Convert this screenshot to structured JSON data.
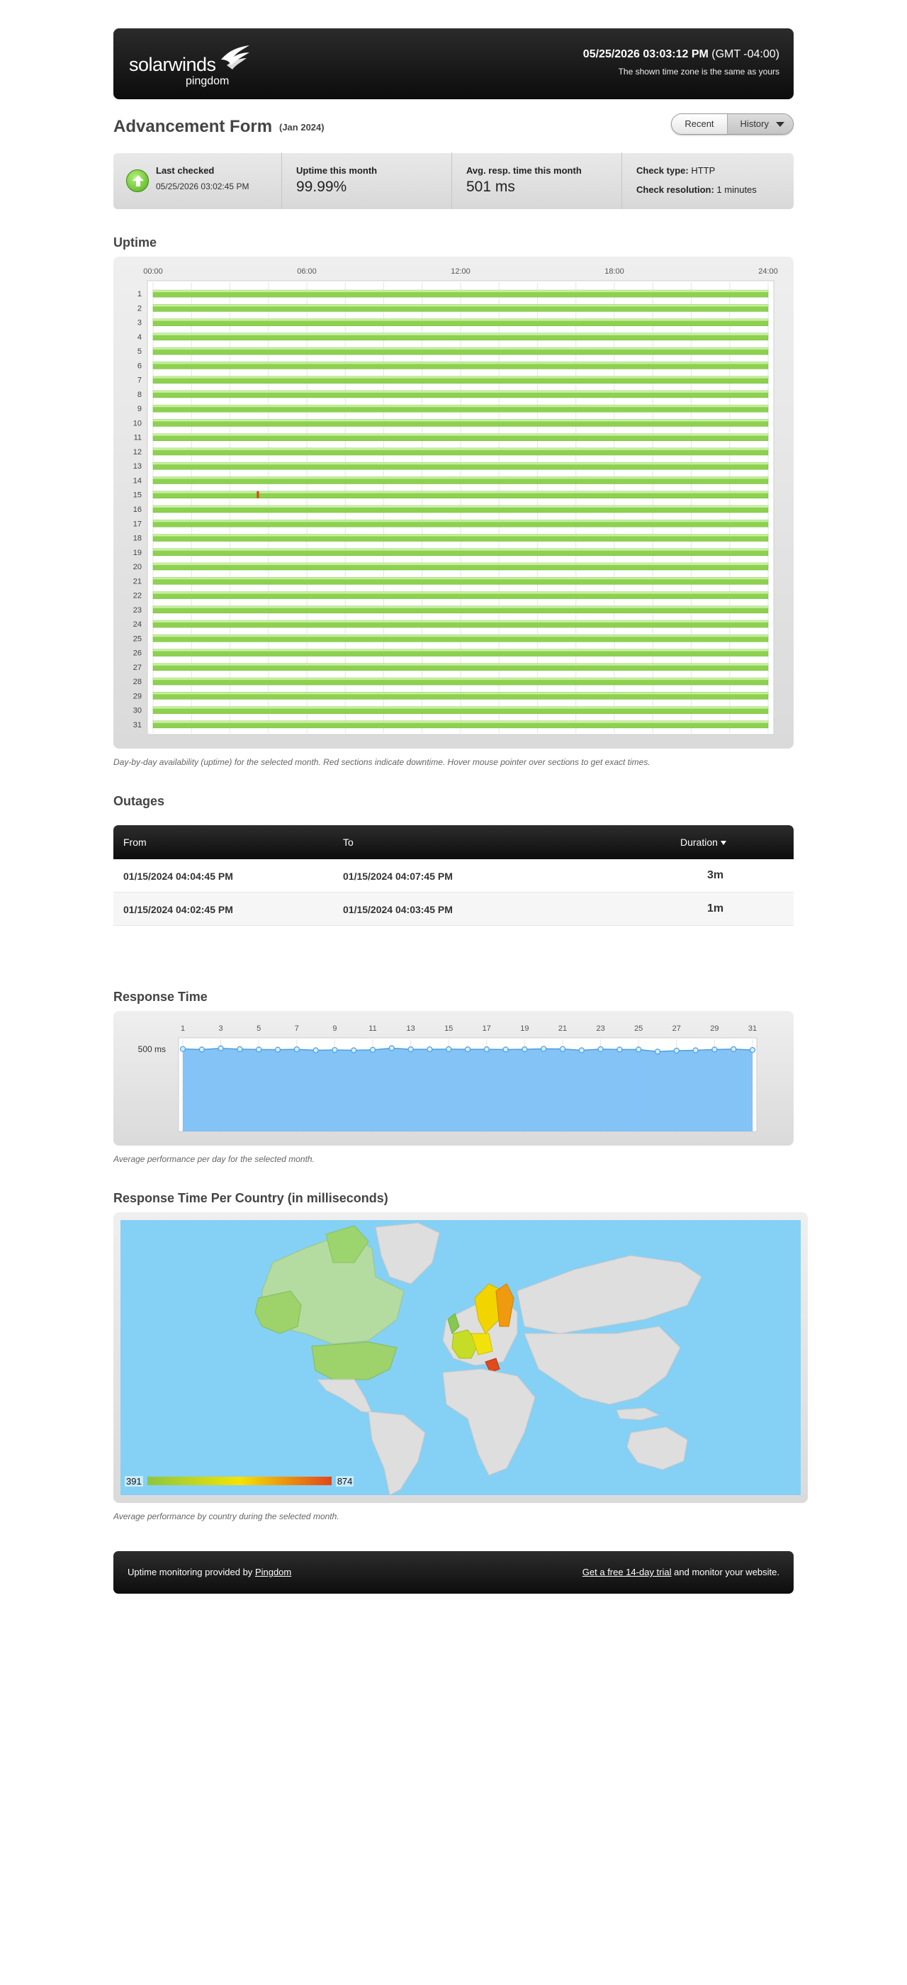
{
  "header": {
    "brand": "solarwinds",
    "product": "pingdom",
    "datetime": "05/25/2026 03:03:12 PM",
    "timezone": "(GMT -04:00)",
    "tz_note": "The shown time zone is the same as yours"
  },
  "page": {
    "title": "Advancement Form",
    "period": "(Jan 2024)",
    "view_toggle": {
      "recent": "Recent",
      "history": "History"
    }
  },
  "summary": {
    "last_checked_label": "Last checked",
    "last_checked_value": "05/25/2026 03:02:45 PM",
    "uptime_label": "Uptime this month",
    "uptime_value": "99.99%",
    "avg_resp_label": "Avg. resp. time this month",
    "avg_resp_value": "501 ms",
    "check_type_label": "Check type:",
    "check_type_value": "HTTP",
    "check_res_label": "Check resolution:",
    "check_res_value": "1 minutes"
  },
  "uptime": {
    "title": "Uptime",
    "caption": "Day-by-day availability (uptime) for the selected month. Red sections indicate downtime. Hover mouse pointer over sections to get exact times.",
    "hour_ticks": [
      "00:00",
      "06:00",
      "12:00",
      "18:00",
      "24:00"
    ],
    "days": [
      "1",
      "2",
      "3",
      "4",
      "5",
      "6",
      "7",
      "8",
      "9",
      "10",
      "11",
      "12",
      "13",
      "14",
      "15",
      "16",
      "17",
      "18",
      "19",
      "20",
      "21",
      "22",
      "23",
      "24",
      "25",
      "26",
      "27",
      "28",
      "29",
      "30",
      "31"
    ],
    "downtime": [
      {
        "day": 15,
        "from": "04:02:45",
        "to": "04:03:45"
      },
      {
        "day": 15,
        "from": "04:04:45",
        "to": "04:07:45"
      }
    ],
    "colors": {
      "up": "#8dd14f",
      "down": "#e2461a"
    }
  },
  "outages": {
    "title": "Outages",
    "headers": {
      "from": "From",
      "to": "To",
      "duration": "Duration"
    },
    "rows": [
      {
        "from": "01/15/2024 04:04:45 PM",
        "to": "01/15/2024 04:07:45 PM",
        "duration": "3m"
      },
      {
        "from": "01/15/2024 04:02:45 PM",
        "to": "01/15/2024 04:03:45 PM",
        "duration": "1m"
      }
    ]
  },
  "response": {
    "title": "Response Time",
    "caption": "Average performance per day for the selected month.",
    "y_tick": "500 ms",
    "x_ticks": [
      "1",
      "3",
      "5",
      "7",
      "9",
      "11",
      "13",
      "15",
      "17",
      "19",
      "21",
      "23",
      "25",
      "27",
      "29",
      "31"
    ],
    "chart_data": {
      "type": "area",
      "x": [
        1,
        2,
        3,
        4,
        5,
        6,
        7,
        8,
        9,
        10,
        11,
        12,
        13,
        14,
        15,
        16,
        17,
        18,
        19,
        20,
        21,
        22,
        23,
        24,
        25,
        26,
        27,
        28,
        29,
        30,
        31
      ],
      "values": [
        502,
        499,
        506,
        501,
        499,
        498,
        500,
        494,
        496,
        494,
        497,
        507,
        500,
        500,
        501,
        500,
        500,
        499,
        500,
        503,
        502,
        494,
        501,
        499,
        499,
        486,
        492,
        494,
        499,
        501,
        496
      ],
      "ylim": [
        0,
        1150
      ],
      "y_ticks": [
        500
      ],
      "grid": true,
      "color": "#7cc0f5"
    }
  },
  "map": {
    "title": "Response Time Per Country (in milliseconds)",
    "caption": "Average performance by country during the selected month.",
    "legend_min": "391",
    "legend_max": "874"
  },
  "footer": {
    "left_text": "Uptime monitoring provided by",
    "left_link": "Pingdom",
    "right_link": "Get a free 14-day trial",
    "right_text": "and monitor your website."
  }
}
